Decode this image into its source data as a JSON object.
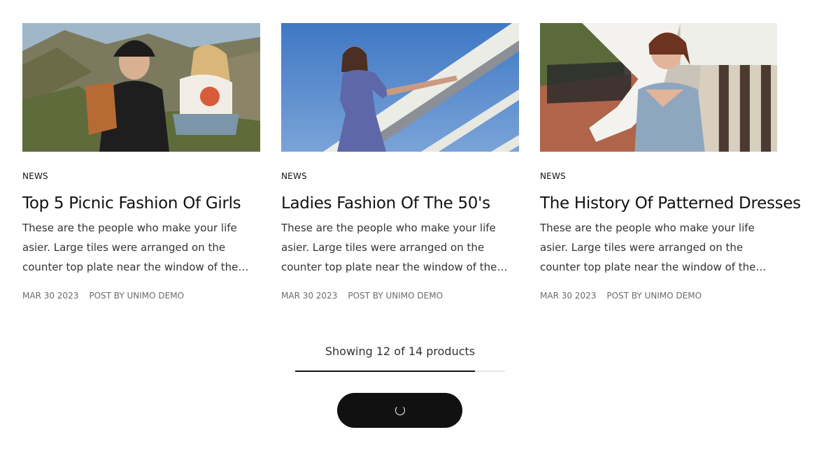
{
  "articles": [
    {
      "category": "NEWS",
      "title": "Top 5 Picnic Fashion Of Girls",
      "excerpt": "These are the people who make your life asier. Large tiles were arranged on the counter top plate near the window of the living room, they…",
      "date": "MAR 30 2023",
      "author": "POST BY UNIMO DEMO"
    },
    {
      "category": "NEWS",
      "title": "Ladies Fashion Of The 50's",
      "excerpt": "These are the people who make your life asier. Large tiles were arranged on the counter top plate near the window of the living room, they…",
      "date": "MAR 30 2023",
      "author": "POST BY UNIMO DEMO"
    },
    {
      "category": "NEWS",
      "title": "The History Of Patterned Dresses",
      "excerpt": "These are the people who make your life asier. Large tiles were arranged on the counter top plate near the window of the living room, they…",
      "date": "MAR 30 2023",
      "author": "POST BY UNIMO DEMO"
    }
  ],
  "pagination": {
    "showing_text": "Showing 12 of 14 products",
    "shown": 12,
    "total": 14,
    "load_more_state": "loading",
    "spinner_icon": "loading-spinner-icon"
  },
  "colors": {
    "accent": "#111111",
    "track": "#e6e6e6",
    "meta_text": "#6b6b6b"
  }
}
